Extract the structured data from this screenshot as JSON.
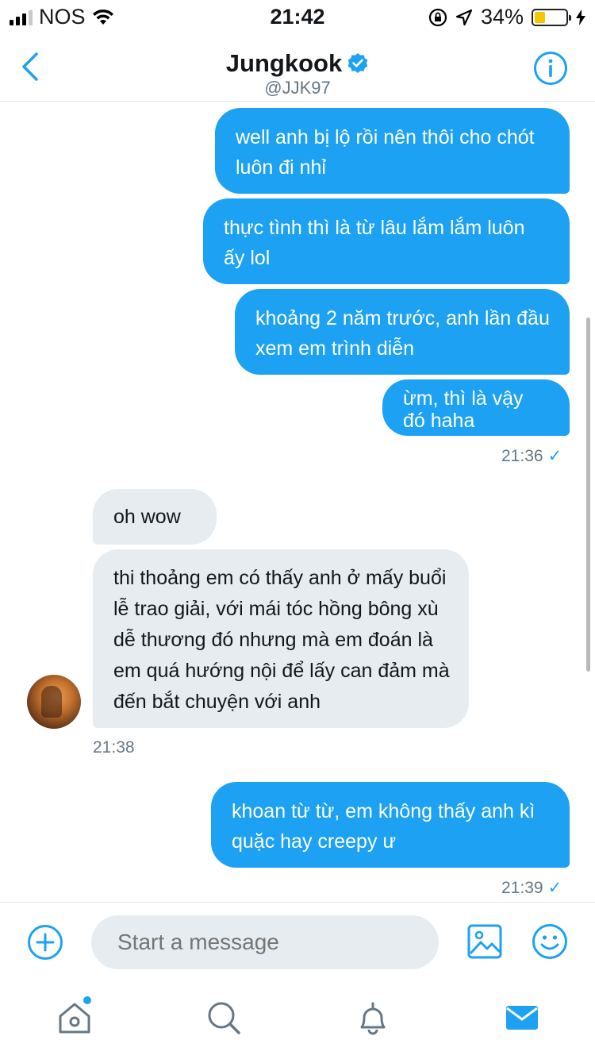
{
  "status_bar": {
    "carrier": "NOS",
    "time": "21:42",
    "battery": "34%"
  },
  "header": {
    "title": "Jungkook",
    "handle": "@JJK97"
  },
  "messages": [
    {
      "text": "well anh bị lộ rồi nên thôi cho chót luôn đi nhỉ"
    },
    {
      "text": "thực tình thì là từ lâu lắm lắm luôn ấy lol"
    },
    {
      "text": "khoảng 2 năm trước, anh lần đầu xem em trình diễn"
    },
    {
      "text": "ừm, thì là vậy đó haha"
    },
    {
      "text": "oh wow"
    },
    {
      "text": "thi thoảng em có thấy anh ở mấy buổi lễ trao giải, với mái tóc hồng bông xù dễ thương đó nhưng mà em đoán là em quá hướng nội để lấy can đảm mà đến bắt chuyện với anh"
    },
    {
      "text": "khoan từ từ, em không thấy anh kì quặc hay creepy ư"
    }
  ],
  "timestamps": [
    "21:36",
    "21:38",
    "21:39"
  ],
  "composer": {
    "placeholder": "Start a message"
  },
  "colors": {
    "accent": "#1da1f2",
    "incoming_bubble": "#e6ecf0"
  }
}
